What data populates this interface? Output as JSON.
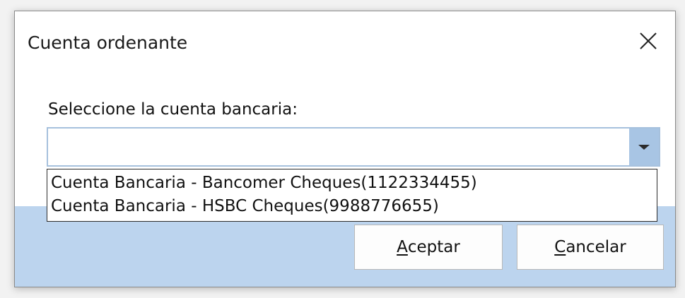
{
  "dialog": {
    "title": "Cuenta ordenante",
    "close_icon": "close-icon"
  },
  "form": {
    "prompt": "Seleccione la cuenta bancaria:",
    "selected_value": "",
    "dropdown_icon": "chevron-down-icon",
    "options": [
      "Cuenta Bancaria - Bancomer Cheques(1122334455)",
      "Cuenta Bancaria - HSBC Cheques(9988776655)"
    ]
  },
  "buttons": {
    "accept_mnemonic": "A",
    "accept_rest": "ceptar",
    "cancel_mnemonic": "C",
    "cancel_rest": "ancelar"
  },
  "colors": {
    "footer_background": "#bcd4ee",
    "combo_button": "#a8c5e4",
    "combo_border": "#a6c1dd"
  }
}
